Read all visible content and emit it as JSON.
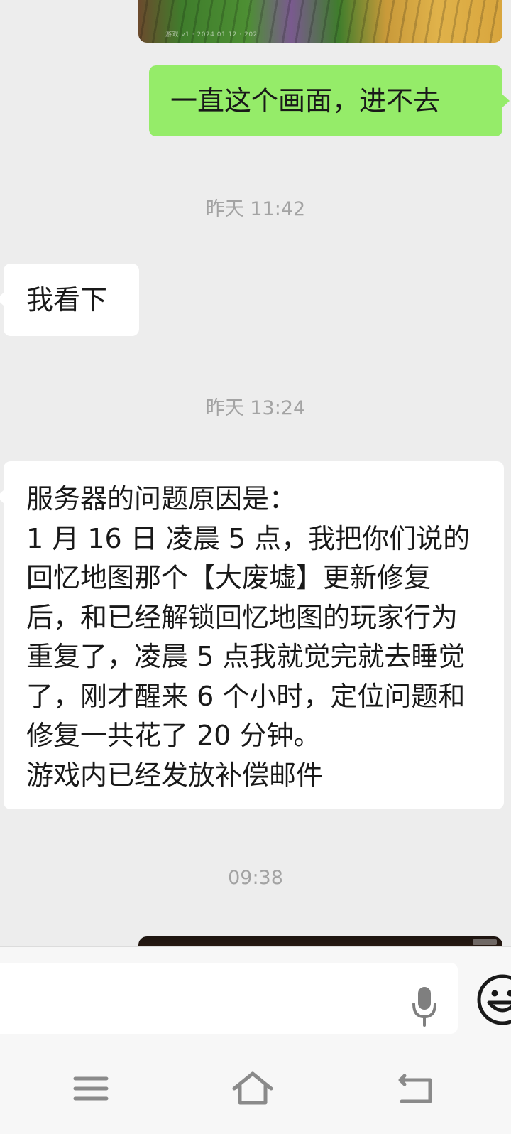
{
  "chat": {
    "top_image": {
      "stamp": "游戏 v1 · 2024 01 12 · 202"
    },
    "messages": [
      {
        "side": "out",
        "text": "一直这个画面，进不去"
      },
      {
        "type": "timestamp",
        "text": "昨天 11:42"
      },
      {
        "side": "in",
        "text": "我看下"
      },
      {
        "type": "timestamp",
        "text": "昨天 13:24"
      },
      {
        "side": "in",
        "text": "服务器的问题原因是：\n1 月 16 日 凌晨 5 点，我把你们说的回忆地图那个【大废墟】更新修复后，和已经解锁回忆地图的玩家行为重复了，凌晨 5 点我就觉完就去睡觉了，刚才醒来 6 个小时，定位问题和修复一共花了 20 分钟。\n游戏内已经发放补偿邮件"
      },
      {
        "type": "timestamp",
        "text": "09:38"
      }
    ]
  },
  "input_bar": {
    "message_input_value": "",
    "icons": [
      "microphone-icon",
      "emoji-icon"
    ]
  },
  "nav_bar": {
    "icons": [
      "menu-icon",
      "home-icon",
      "back-icon"
    ]
  },
  "colors": {
    "background": "#ededed",
    "outgoing_bubble": "#95ec69",
    "incoming_bubble": "#ffffff",
    "timestamp_text": "#a3a3a3"
  }
}
